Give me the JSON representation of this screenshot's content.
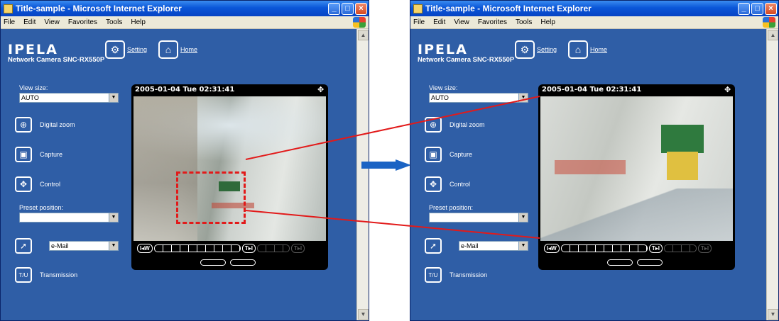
{
  "window": {
    "title": "Title-sample - Microsoft Internet Explorer",
    "menu": [
      "File",
      "Edit",
      "View",
      "Favorites",
      "Tools",
      "Help"
    ]
  },
  "header": {
    "brand": "IPELA",
    "model": "Network Camera SNC-RX550P",
    "setting_label": "Setting",
    "home_label": "Home"
  },
  "controls": {
    "view_size_label": "View size:",
    "view_size_value": "AUTO",
    "digital_zoom_label": "Digital zoom",
    "capture_label": "Capture",
    "control_label": "Control",
    "preset_label": "Preset position:",
    "preset_value": "",
    "email_value": "e-Mail",
    "transmission_label": "Transmission"
  },
  "viewer": {
    "timestamp": "2005-01-04 Tue 02:31:41",
    "wide_label": "W",
    "tele_label": "T"
  },
  "colors": {
    "page_bg": "#2f5ea6",
    "zoom_box": "#e21a1a",
    "arrow": "#1a63c4"
  },
  "icons": [
    "ie-icon",
    "setting-icon",
    "home-icon",
    "digital-zoom-icon",
    "capture-icon",
    "control-icon",
    "email-action-icon",
    "transmission-icon",
    "move-icon"
  ]
}
